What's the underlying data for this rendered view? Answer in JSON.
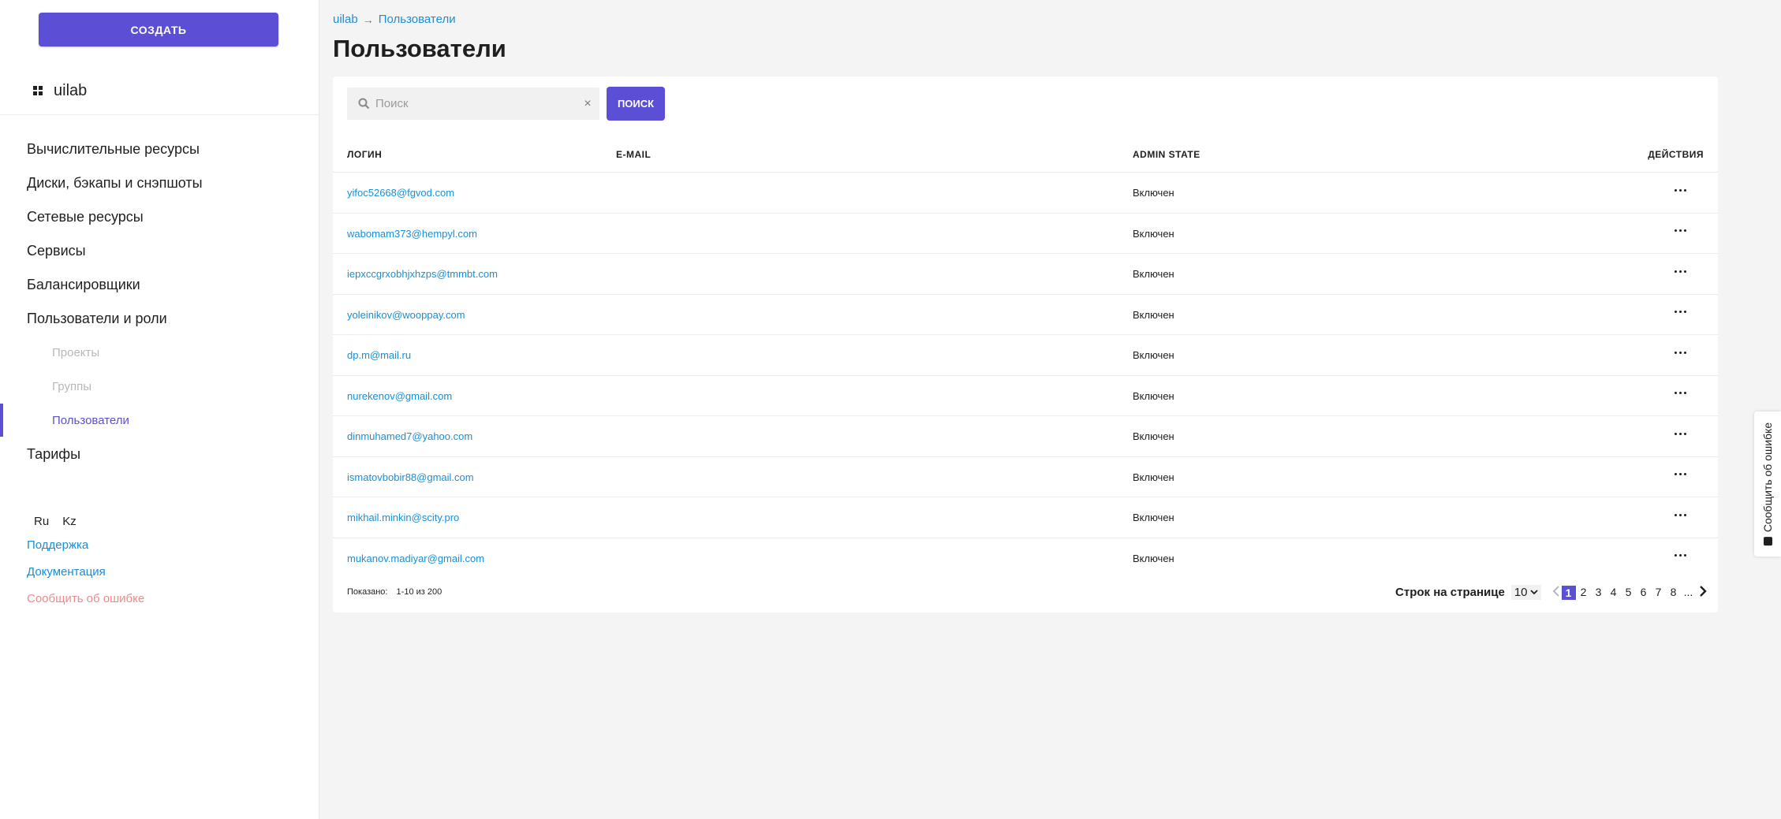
{
  "sidebar": {
    "create_label": "СОЗДАТЬ",
    "brand": "uilab",
    "nav": [
      "Вычислительные ресурсы",
      "Диски, бэкапы и снэпшоты",
      "Сетевые ресурсы",
      "Сервисы",
      "Балансировщики",
      "Пользователи и роли"
    ],
    "subnav": [
      "Проекты",
      "Группы",
      "Пользователи"
    ],
    "tariffs": "Тарифы",
    "langs": [
      "Ru",
      "Kz"
    ],
    "support": "Поддержка",
    "docs": "Документация",
    "report_error": "Сообщить об ошибке"
  },
  "breadcrumb": {
    "root": "uilab",
    "arrow": "→",
    "current": "Пользователи"
  },
  "page_title": "Пользователи",
  "search": {
    "placeholder": "Поиск",
    "button": "ПОИСК",
    "clear": "×"
  },
  "table": {
    "columns": {
      "login": "ЛОГИН",
      "email": "E-MAIL",
      "admin_state": "ADMIN STATE",
      "actions": "ДЕЙСТВИЯ"
    },
    "rows": [
      {
        "login": "yifoc52668@fgvod.com",
        "state": "Включен"
      },
      {
        "login": "wabomam373@hempyl.com",
        "state": "Включен"
      },
      {
        "login": "iepxccgrxobhjxhzps@tmmbt.com",
        "state": "Включен"
      },
      {
        "login": "yoleinikov@wooppay.com",
        "state": "Включен"
      },
      {
        "login": "dp.m@mail.ru",
        "state": "Включен"
      },
      {
        "login": "nurekenov@gmail.com",
        "state": "Включен"
      },
      {
        "login": "dinmuhamed7@yahoo.com",
        "state": "Включен"
      },
      {
        "login": "ismatovbobir88@gmail.com",
        "state": "Включен"
      },
      {
        "login": "mikhail.minkin@scity.pro",
        "state": "Включен"
      },
      {
        "login": "mukanov.madiyar@gmail.com",
        "state": "Включен"
      }
    ]
  },
  "footer": {
    "shown_label": "Показано:",
    "shown_range": "1-10 из 200",
    "rows_per_page_label": "Строк на странице",
    "rows_per_page_value": "10",
    "pages": [
      "1",
      "2",
      "3",
      "4",
      "5",
      "6",
      "7",
      "8",
      "..."
    ],
    "current_page": "1"
  },
  "report_tab": "Сообщить об ошибке",
  "colors": {
    "accent": "#5b4fd6",
    "link": "#1a8fd6",
    "error_link": "#ef8a8a"
  }
}
